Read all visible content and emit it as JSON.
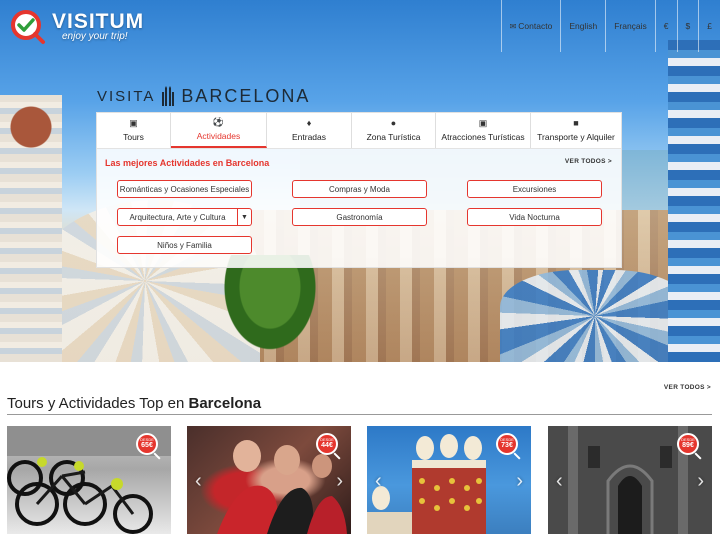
{
  "brand": {
    "name": "VISITUM",
    "tagline": "enjoy your trip!"
  },
  "topnav": [
    {
      "label": "Contacto",
      "icon": "envelope-icon"
    },
    {
      "label": "English"
    },
    {
      "label": "Français"
    },
    {
      "label": "€"
    },
    {
      "label": "$"
    },
    {
      "label": "£"
    }
  ],
  "hero": {
    "prefix": "VISITA",
    "city": "BARCELONA"
  },
  "tabs": [
    {
      "label": "Tours",
      "icon": "camera-icon"
    },
    {
      "label": "Actividades",
      "icon": "ball-icon",
      "active": true
    },
    {
      "label": "Entradas",
      "icon": "ticket-icon"
    },
    {
      "label": "Zona Turística",
      "icon": "map-pin-icon"
    },
    {
      "label": "Atracciones Turísticas",
      "icon": "camera-attraction-icon"
    },
    {
      "label": "Transporte y Alquiler",
      "icon": "car-icon"
    }
  ],
  "panel": {
    "subtitle": "Las mejores Actividades en Barcelona",
    "ver_todos": "VER TODOS >",
    "pills": [
      "Románticas y Ocasiones Especiales",
      "Compras y Moda",
      "Excursiones",
      "Arquitectura, Arte y Cultura",
      "Gastronomía",
      "Vida Nocturna",
      "Niños y Familia"
    ]
  },
  "section": {
    "ver_todos": "VER TODOS >",
    "title_prefix": "Tours y Actividades Top en ",
    "title_city": "Barcelona"
  },
  "cards": [
    {
      "badge_label": "DESDE",
      "price": "65€",
      "image": "bicycles"
    },
    {
      "badge_label": "DESDE",
      "price": "44€",
      "image": "flamenco-dancers"
    },
    {
      "badge_label": "DESDE",
      "price": "73€",
      "image": "dali-museum"
    },
    {
      "badge_label": "DESDE",
      "price": "89€",
      "image": "gothic-quarter"
    }
  ],
  "colors": {
    "accent": "#e5362e",
    "text": "#222222"
  }
}
